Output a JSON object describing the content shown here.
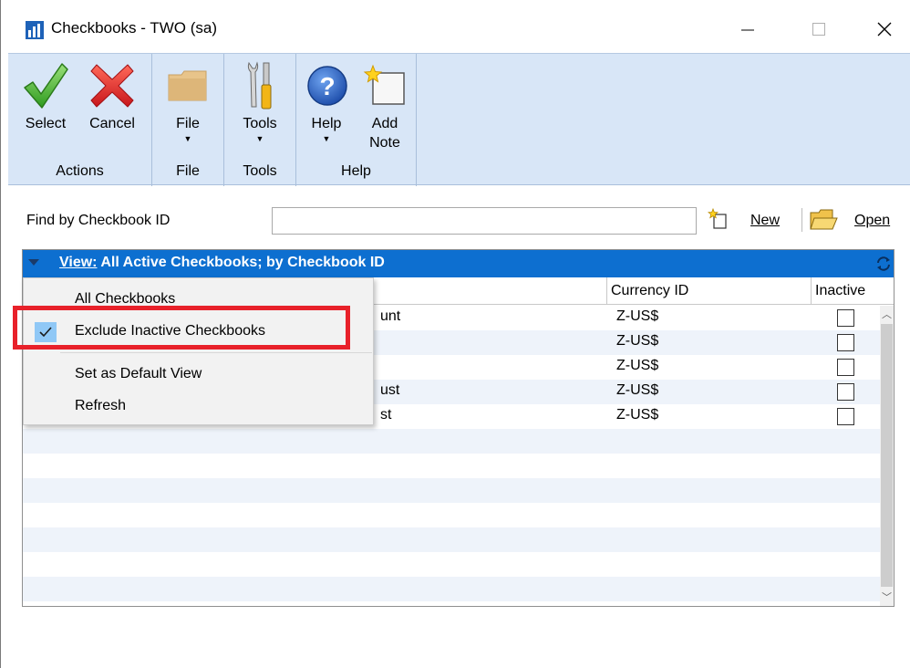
{
  "window": {
    "title": "Checkbooks  -  TWO (sa)",
    "controls": {
      "minimize": "—",
      "maximize": "☐",
      "close": "✕"
    }
  },
  "ribbon": {
    "groups": [
      {
        "label": "Actions",
        "buttons": [
          {
            "label": "Select",
            "icon": "check-icon"
          },
          {
            "label": "Cancel",
            "icon": "cancel-icon"
          }
        ]
      },
      {
        "label": "File",
        "buttons": [
          {
            "label": "File",
            "icon": "folder-icon",
            "has_dropdown": true
          }
        ]
      },
      {
        "label": "Tools",
        "buttons": [
          {
            "label": "Tools",
            "icon": "tools-icon",
            "has_dropdown": true
          }
        ]
      },
      {
        "label": "Help",
        "buttons": [
          {
            "label": "Help",
            "icon": "help-icon",
            "has_dropdown": true
          },
          {
            "label": "Add",
            "label2": "Note",
            "icon": "add-note-icon"
          }
        ]
      }
    ]
  },
  "find": {
    "label": "Find by Checkbook ID",
    "value": "",
    "new_label": "New",
    "open_label": "Open"
  },
  "list": {
    "view_prefix": "View:",
    "view_text": " All Active Checkbooks; by Checkbook ID",
    "columns": {
      "currency_id": "Currency ID",
      "inactive": "Inactive"
    },
    "rows": [
      {
        "desc_fragment": "unt",
        "currency": "Z-US$",
        "inactive": false
      },
      {
        "desc_fragment": "",
        "currency": "Z-US$",
        "inactive": false
      },
      {
        "desc_fragment": "",
        "currency": "Z-US$",
        "inactive": false
      },
      {
        "desc_fragment": "ust",
        "currency": "Z-US$",
        "inactive": false
      },
      {
        "desc_fragment": "st",
        "currency": "Z-US$",
        "inactive": false
      }
    ]
  },
  "view_menu": {
    "items": [
      {
        "label": "All Checkbooks",
        "checked": false
      },
      {
        "label": "Exclude Inactive Checkbooks",
        "checked": true
      },
      {
        "label": "Set as Default View",
        "checked": false
      },
      {
        "label": "Refresh",
        "checked": false
      }
    ]
  },
  "colors": {
    "view_bar": "#0d6fd0",
    "ribbon_bg": "#d8e6f7",
    "highlight": "#e8212a",
    "menu_check_bg": "#90c8f6"
  }
}
